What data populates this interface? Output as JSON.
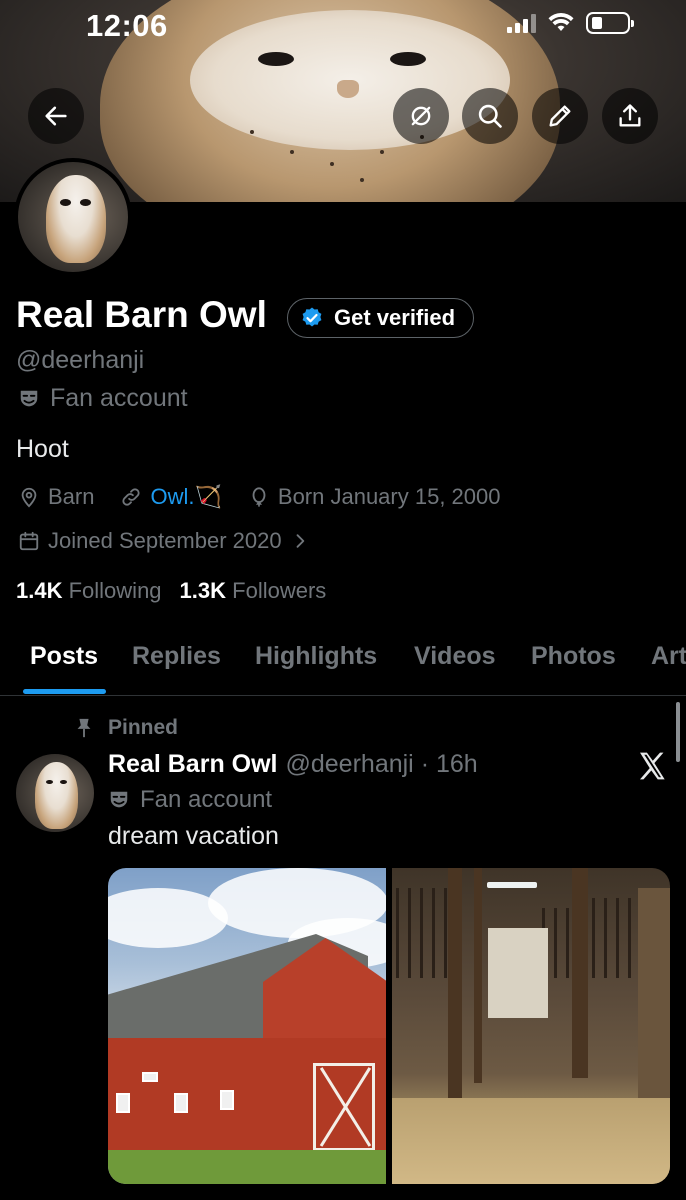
{
  "status_bar": {
    "time": "12:06"
  },
  "profile": {
    "name": "Real Barn Owl",
    "get_verified_label": "Get verified",
    "handle": "@deerhanji",
    "account_label": "Fan account",
    "bio": "Hoot",
    "location": "Barn",
    "link_text": "Owl.🏹",
    "born": "Born January 15, 2000",
    "joined": "Joined September 2020",
    "following_count": "1.4K",
    "following_label": "Following",
    "followers_count": "1.3K",
    "followers_label": "Followers"
  },
  "tabs": [
    "Posts",
    "Replies",
    "Highlights",
    "Videos",
    "Photos",
    "Art"
  ],
  "active_tab": "Posts",
  "pinned_post": {
    "pinned_label": "Pinned",
    "author_name": "Real Barn Owl",
    "author_handle": "@deerhanji",
    "separator": "·",
    "time_ago": "16h",
    "account_label": "Fan account",
    "text": "dream vacation"
  },
  "colors": {
    "accent": "#1d9bf0",
    "background": "#000000",
    "muted": "#71767b",
    "text": "#e7e9ea"
  },
  "icons": [
    "back-arrow-icon",
    "dim-icon",
    "search-icon",
    "edit-pencil-icon",
    "share-icon",
    "verified-check-icon",
    "theater-mask-icon",
    "location-pin-icon",
    "link-icon",
    "balloon-icon",
    "calendar-icon",
    "chevron-right-icon",
    "pin-icon",
    "x-logo-icon"
  ]
}
